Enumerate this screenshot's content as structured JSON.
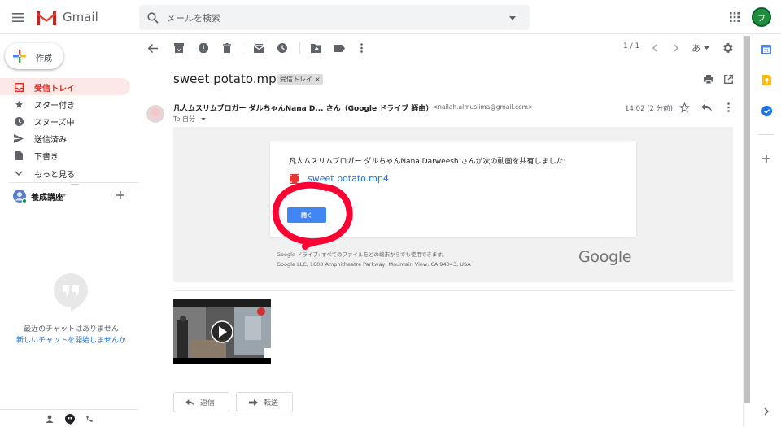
{
  "header": {
    "app_name": "Gmail",
    "search_placeholder": "メールを検索",
    "avatar_letter": "フ"
  },
  "sidebar": {
    "compose_label": "作成",
    "items": [
      {
        "label": "受信トレイ",
        "icon": "inbox-icon",
        "active": true
      },
      {
        "label": "スター付き",
        "icon": "star-icon"
      },
      {
        "label": "スヌーズ中",
        "icon": "clock-icon"
      },
      {
        "label": "送信済み",
        "icon": "send-icon"
      },
      {
        "label": "下書き",
        "icon": "draft-icon"
      },
      {
        "label": "もっと見る",
        "icon": "chevron-down-icon"
      }
    ],
    "hangouts_user": "養成講座",
    "chat_empty": "最近のチャットはありません",
    "chat_start": "新しいチャットを開始しませんか"
  },
  "toolbar": {
    "pager": "1 / 1",
    "lang": "あ"
  },
  "message": {
    "subject": "sweet potato.mp4",
    "label_chip": "受信トレイ",
    "sender_name": "凡人ムスリムブロガー ダルちゃんNana D... さん（Google ドライブ 経由）",
    "sender_email": "<nailah.almuslima@gmail.com>",
    "to": "To 自分",
    "time": "14:02 (2 分前)",
    "share_text": "凡人ムスリムブロガー ダルちゃんNana Darweesh さんが次の動画を共有しました:",
    "file_name": "sweet potato.mp4",
    "open_button": "開く",
    "footer_line1": "Google ドライブ: すべてのファイルをどの端末からでも使用できます。",
    "footer_line2": "Google LLC, 1600 Amphitheatre Parkway, Mountain View, CA 94043, USA",
    "google_logo": "Google"
  },
  "actions": {
    "reply": "返信",
    "forward": "転送"
  },
  "colors": {
    "gmail_red": "#ea4335",
    "link_blue": "#1a73e8",
    "button_blue": "#4285f4",
    "annotation_red": "#ff0033"
  }
}
